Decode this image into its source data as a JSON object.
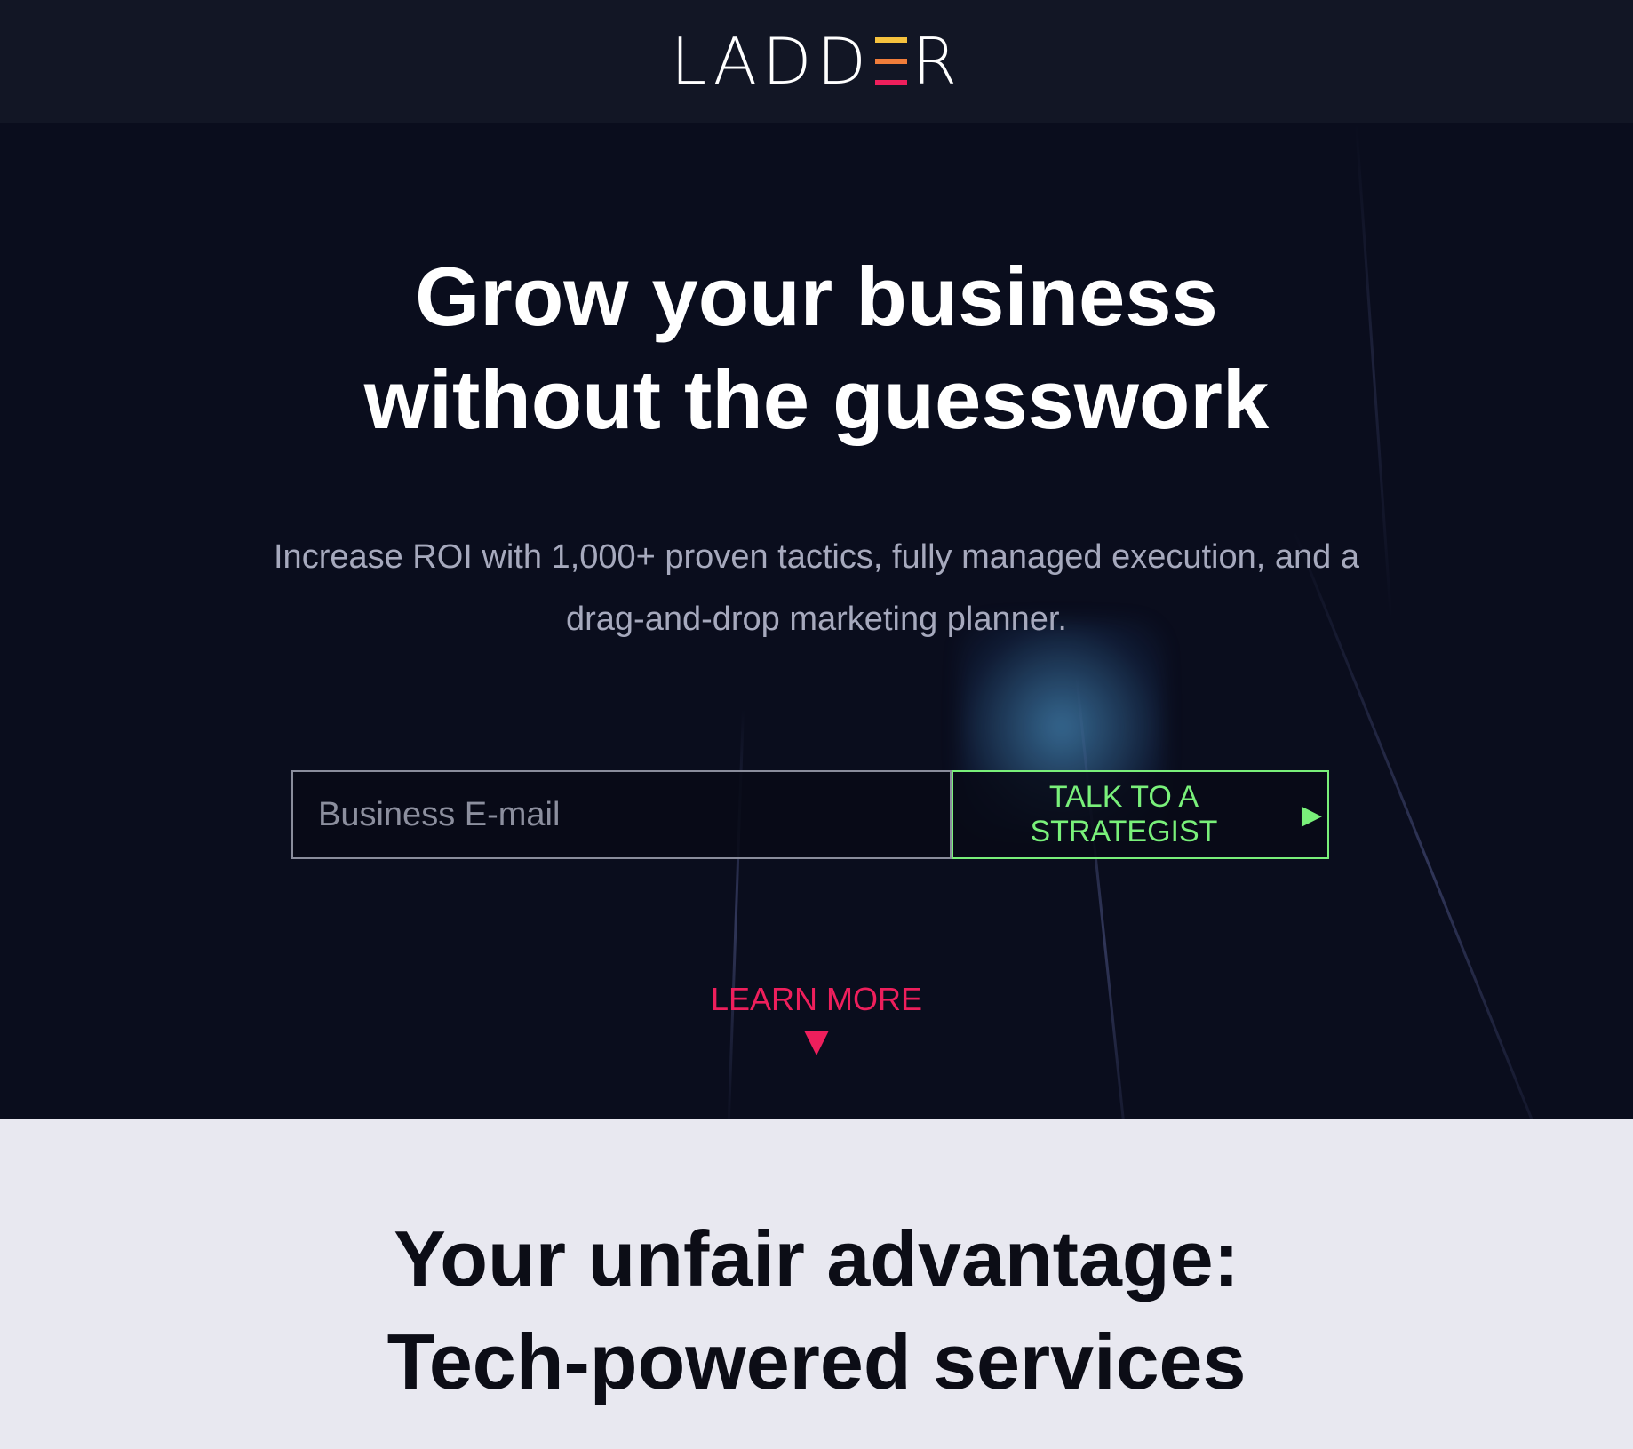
{
  "header": {
    "logo_left": "LADD",
    "logo_right": "R",
    "logo_e_colors": [
      "#f6c23e",
      "#f07d3a",
      "#ee1f5c"
    ]
  },
  "hero": {
    "title_line1": "Grow your business",
    "title_line2": "without the guesswork",
    "subtitle_line1": "Increase ROI with 1,000+ proven tactics, fully managed execution, and a",
    "subtitle_line2": "drag-and-drop marketing planner.",
    "email_placeholder": "Business E-mail",
    "cta_label": "TALK TO A STRATEGIST",
    "cta_icon": "play-icon",
    "learn_more_label": "LEARN MORE",
    "learn_more_icon": "triangle-down-icon"
  },
  "section": {
    "title_line1": "Your unfair advantage:",
    "title_line2": "Tech-powered services"
  },
  "colors": {
    "header_bg": "#121625",
    "hero_bg": "#0a0d1d",
    "accent_green": "#79f07a",
    "accent_pink": "#ee1f5c",
    "section_bg": "#e8e8f0"
  }
}
